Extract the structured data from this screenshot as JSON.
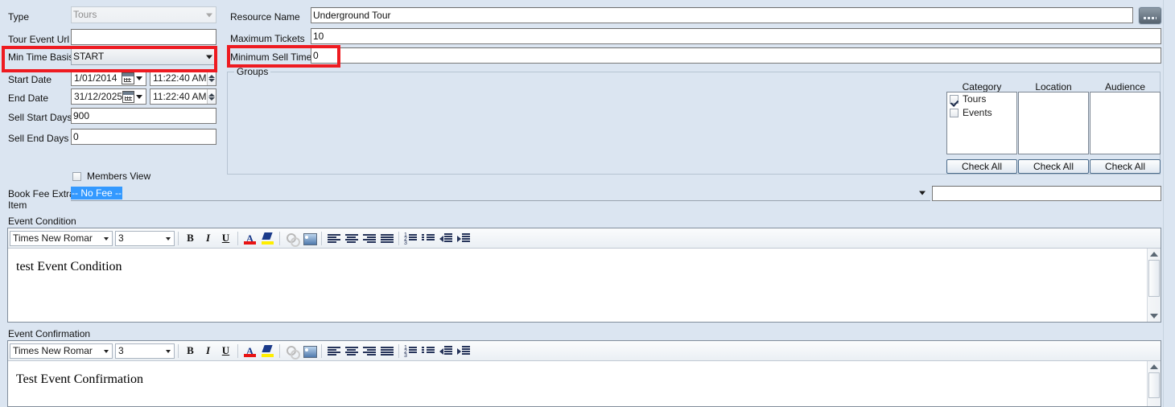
{
  "form": {
    "left_fields": {
      "type": {
        "label": "Type",
        "value": "Tours",
        "disabled": true
      },
      "tour_event_url": {
        "label": "Tour Event Url",
        "value": ""
      },
      "min_time_basis": {
        "label": "Min Time Basis",
        "value": "START",
        "highlighted": true
      },
      "start_date": {
        "label": "Start Date",
        "date": "1/01/2014",
        "time": "11:22:40 AM"
      },
      "end_date": {
        "label": "End Date",
        "date": "31/12/2025",
        "time": "11:22:40 AM"
      },
      "sell_start_days": {
        "label": "Sell Start Days",
        "value": "900"
      },
      "sell_end_days": {
        "label": "Sell End Days",
        "value": "0"
      },
      "members_view": {
        "label": "Members View",
        "checked": false
      },
      "book_fee_extra_item": {
        "label_line1": "Book Fee Extra",
        "label_line2": "Item",
        "value": "-- No Fee --",
        "secondary_value": ""
      }
    },
    "right_fields": {
      "resource_name": {
        "label": "Resource Name",
        "value": "Underground Tour"
      },
      "maximum_tickets": {
        "label": "Maximum Tickets",
        "value": "10"
      },
      "minimum_sell_time": {
        "label": "Minimum Sell Time",
        "value": "0",
        "highlighted": true
      }
    },
    "browse_button": {
      "label": "...",
      "icon": "ellipsis-icon"
    },
    "groups": {
      "title": "Groups",
      "columns": [
        {
          "header": "Category",
          "items": [
            {
              "label": "Tours",
              "checked": true
            },
            {
              "label": "Events",
              "checked": false
            }
          ],
          "check_all_label": "Check All"
        },
        {
          "header": "Location",
          "items": [],
          "check_all_label": "Check All"
        },
        {
          "header": "Audience",
          "items": [],
          "check_all_label": "Check All"
        }
      ]
    },
    "editors": [
      {
        "section_label": "Event Condition",
        "font_name": "Times New Romar",
        "font_size": "3",
        "content": "test Event Condition"
      },
      {
        "section_label": "Event Confirmation",
        "font_name": "Times New Romar",
        "font_size": "3",
        "content": "Test Event Confirmation"
      }
    ],
    "toolbar_buttons": [
      {
        "name": "bold-icon",
        "glyph": "B"
      },
      {
        "name": "italic-icon",
        "glyph": "I"
      },
      {
        "name": "underline-icon",
        "glyph": "U"
      },
      {
        "name": "font-color-icon",
        "glyph": "A"
      },
      {
        "name": "highlight-icon",
        "glyph": "✏"
      },
      {
        "name": "link-icon",
        "glyph": "⛓"
      },
      {
        "name": "image-icon",
        "glyph": "🖼"
      },
      {
        "name": "align-left-icon",
        "glyph": "≡"
      },
      {
        "name": "align-center-icon",
        "glyph": "≡"
      },
      {
        "name": "align-right-icon",
        "glyph": "≡"
      },
      {
        "name": "align-justify-icon",
        "glyph": "≡"
      },
      {
        "name": "numbered-list-icon",
        "glyph": "1."
      },
      {
        "name": "bulleted-list-icon",
        "glyph": "•"
      },
      {
        "name": "decrease-indent-icon",
        "glyph": "⇤"
      },
      {
        "name": "increase-indent-icon",
        "glyph": "⇥"
      }
    ]
  },
  "colors": {
    "background": "#dbe5f1",
    "highlight_red": "#ee1b21",
    "selection_blue": "#3399ff",
    "font_color_swatch": "#e81313",
    "highlight_swatch": "#ffee00"
  }
}
